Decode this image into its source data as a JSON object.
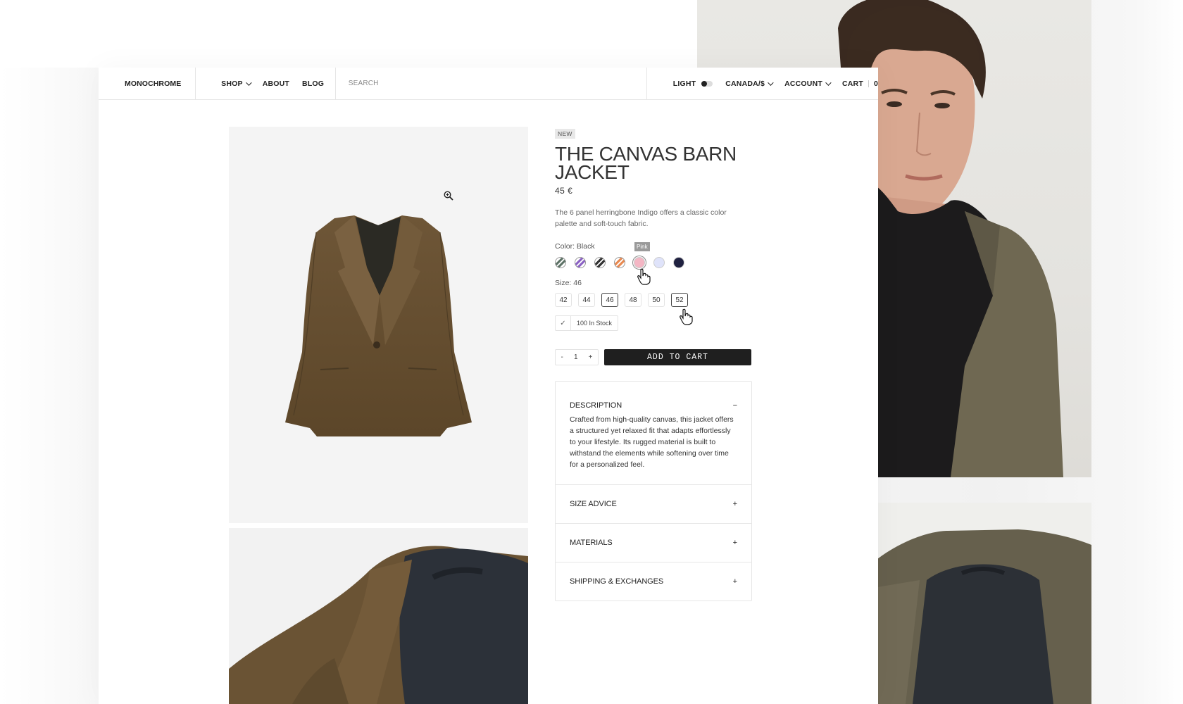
{
  "nav": {
    "brand": "MONOCHROME",
    "links": [
      {
        "label": "SHOP",
        "has_dropdown": true
      },
      {
        "label": "ABOUT",
        "has_dropdown": false
      },
      {
        "label": "BLOG",
        "has_dropdown": false
      }
    ],
    "search_placeholder": "SEARCH",
    "theme_label": "LIGHT",
    "region": "CANADA/$",
    "account": "ACCOUNT",
    "cart_label": "CART",
    "cart_count": "0"
  },
  "product": {
    "badge": "NEW",
    "title": "THE CANVAS BARN JACKET",
    "price": "45 €",
    "short_description": "The 6 panel herringbone Indigo offers a classic color palette and soft-touch fabric.",
    "color_label": "Color: Black",
    "hover_tooltip": "Pink",
    "colors": [
      {
        "name": "green-stripe",
        "color": "#5f7468"
      },
      {
        "name": "purple-stripe",
        "color": "#8c63c4"
      },
      {
        "name": "black-stripe",
        "color": "#333333"
      },
      {
        "name": "orange-stripe",
        "color": "#e88a52"
      },
      {
        "name": "pink",
        "color": "#f4b6c4"
      },
      {
        "name": "lavender",
        "color": "#dfe3fa"
      },
      {
        "name": "navy",
        "color": "#1f2140"
      }
    ],
    "size_label": "Size: 46",
    "sizes": [
      "42",
      "44",
      "46",
      "48",
      "50",
      "52"
    ],
    "selected_size": "46",
    "stock_text": "100 In Stock",
    "quantity": "1",
    "qty_minus": "-",
    "qty_plus": "+",
    "add_to_cart": "ADD TO CART"
  },
  "accordion": [
    {
      "title": "DESCRIPTION",
      "icon": "−",
      "open": true,
      "body": "Crafted from high-quality canvas, this jacket offers a structured yet relaxed fit that adapts effortlessly to your lifestyle. Its rugged material is built to withstand the elements while softening over time for a personalized feel."
    },
    {
      "title": "SIZE ADVICE",
      "icon": "+",
      "open": false
    },
    {
      "title": "MATERIALS",
      "icon": "+",
      "open": false
    },
    {
      "title": "SHIPPING & EXCHANGES",
      "icon": "+",
      "open": false
    }
  ],
  "colors": {
    "jacket": "#6b5335",
    "button_bg": "#1f1f1f",
    "panel_bg": "#ffffff",
    "gallery_bg": "#f4f4f4"
  }
}
